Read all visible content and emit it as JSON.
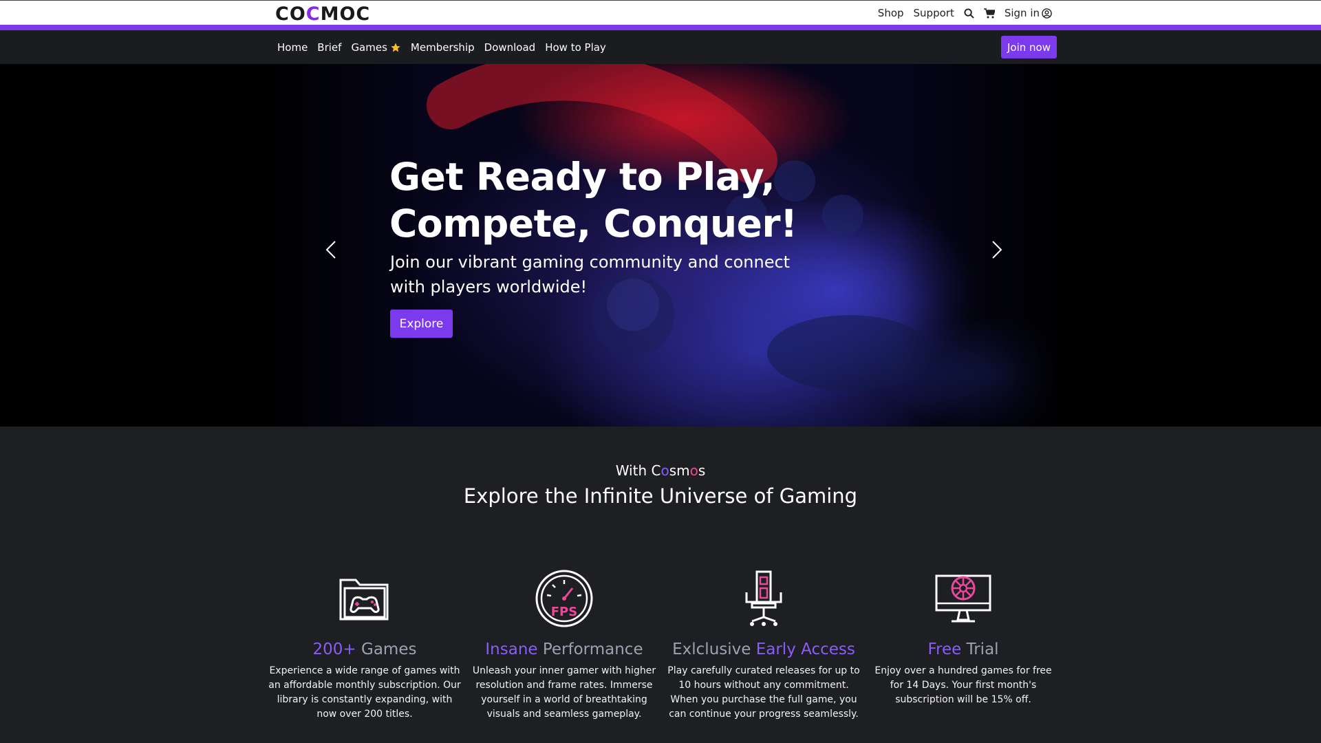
{
  "brand": {
    "logo_text_a": "CO",
    "logo_text_m": "C",
    "logo_text_b": "MOC"
  },
  "top_links": {
    "shop": "Shop",
    "support": "Support",
    "sign_in": "Sign in"
  },
  "nav": {
    "items": [
      "Home",
      "Brief",
      "Games",
      "Membership",
      "Download",
      "How to Play"
    ],
    "join_label": "Join now"
  },
  "hero": {
    "title": "Get Ready to Play, Compete, Conquer!",
    "subtitle": "Join our vibrant gaming community and connect with players worldwide!",
    "cta": "Explore"
  },
  "section": {
    "with_prefix": "With C",
    "with_o1": "o",
    "with_s": "sm",
    "with_o2": "o",
    "with_end": "s",
    "title": "Explore the Infinite Universe of Gaming"
  },
  "features": [
    {
      "hl": "200+",
      "rest": " Games",
      "text": "Experience a wide range of games with an affordable monthly subscription. Our library is constantly expanding, with now over 200 titles.",
      "icon": "game-folder-icon"
    },
    {
      "hl": "Insane",
      "rest": " Performance",
      "text": "Unleash your inner gamer with higher resolution and frame rates. Immerse yourself in a world of breathtaking visuals and seamless gameplay.",
      "icon": "fps-gauge-icon"
    },
    {
      "pre": "Exlclusive ",
      "hl": "Early Access",
      "text": "Play carefully curated releases for up to 10 hours without any commitment. When you purchase the full game, you can continue your progress seamlessly.",
      "icon": "gaming-chair-icon"
    },
    {
      "hl": "Free",
      "rest": " Trial",
      "text": "Enjoy over a hundred games for free for 14 Days. Your first month's subscription will be 15% off.",
      "icon": "monitor-wheel-icon"
    }
  ],
  "colors": {
    "accent": "#7c3aed",
    "pink": "#ec4899",
    "bg": "#1e1f23"
  }
}
